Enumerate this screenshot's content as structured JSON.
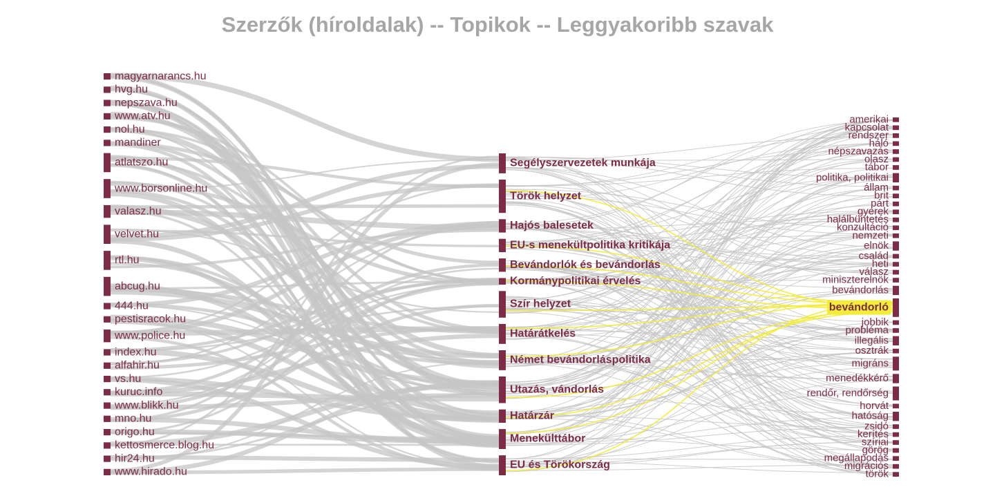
{
  "title": "Szerzők (híroldalak) -- Topikok -- Leggyakoribb szavak",
  "chart_data": {
    "type": "sankey",
    "highlighted_node": "bevándorló",
    "colors": {
      "node": "#7c2d45",
      "link": "#c6c6c6",
      "highlight_link": "#f2ec3a",
      "title": "#a6a6a6"
    },
    "sources": [
      "magyarnarancs.hu",
      "hvg.hu",
      "nepszava.hu",
      "www.atv.hu",
      "nol.hu",
      "mandiner",
      "atlatszo.hu",
      "www.borsonline.hu",
      "valasz.hu",
      "velvet.hu",
      "rtl.hu",
      "abcug.hu",
      "444.hu",
      "pestisracok.hu",
      "www.police.hu",
      "index.hu",
      "alfahir.hu",
      "vs.hu",
      "kuruc.info",
      "www.blikk.hu",
      "mno.hu",
      "origo.hu",
      "kettosmerce.blog.hu",
      "hir24.hu",
      "www.hirado.hu"
    ],
    "source_weights": [
      1,
      1,
      1,
      1,
      1,
      1,
      3,
      3,
      2,
      3,
      3,
      3,
      1,
      1,
      2,
      1,
      1,
      1,
      1,
      1,
      1,
      1,
      1,
      1,
      1
    ],
    "topics": [
      "Segélyszervezetek munkája",
      "Török helyzet",
      "Hajós balesetek",
      "EU-s menekültpolitika kritikája",
      "Bevándorlók és bevándorlás",
      "Kormánypolitikai érvelés",
      "Szír helyzet",
      "Határátkelés",
      "Német bevándorláspolitika",
      "Utazás, vándorlás",
      "Határzár",
      "Menekülttábor",
      "EU és Törökország"
    ],
    "topic_weights": [
      3,
      5,
      2,
      2,
      2,
      1,
      4,
      3,
      3,
      4,
      2,
      3,
      3
    ],
    "words": [
      "amerikai",
      "kapcsolat",
      "rendszer",
      "háló",
      "népszavazás",
      "olasz",
      "tábor",
      "politika, politikai",
      "állam",
      "brit",
      "párt",
      "gyerek",
      "halálbüntetés",
      "konzultáció",
      "nemzeti",
      "elnök",
      "család",
      "heti",
      "válasz",
      "miniszterelnök",
      "bevándorlás",
      "bevándorló",
      "jobbik",
      "probléma",
      "illegális",
      "osztrák",
      "migráns",
      "menedékkérő",
      "rendőr, rendőrség",
      "horvát",
      "hatóság",
      "zsidó",
      "kerítés",
      "szíriai",
      "görög",
      "megállapodás",
      "migrációs",
      "török"
    ],
    "word_weights": [
      1,
      1,
      1,
      1,
      1,
      1,
      1,
      2,
      1,
      1,
      1,
      1,
      1,
      1,
      1,
      2,
      1,
      1,
      1,
      1,
      2,
      4,
      1,
      1,
      2,
      1,
      3,
      2,
      3,
      1,
      2,
      1,
      1,
      1,
      1,
      1,
      1,
      1
    ]
  }
}
